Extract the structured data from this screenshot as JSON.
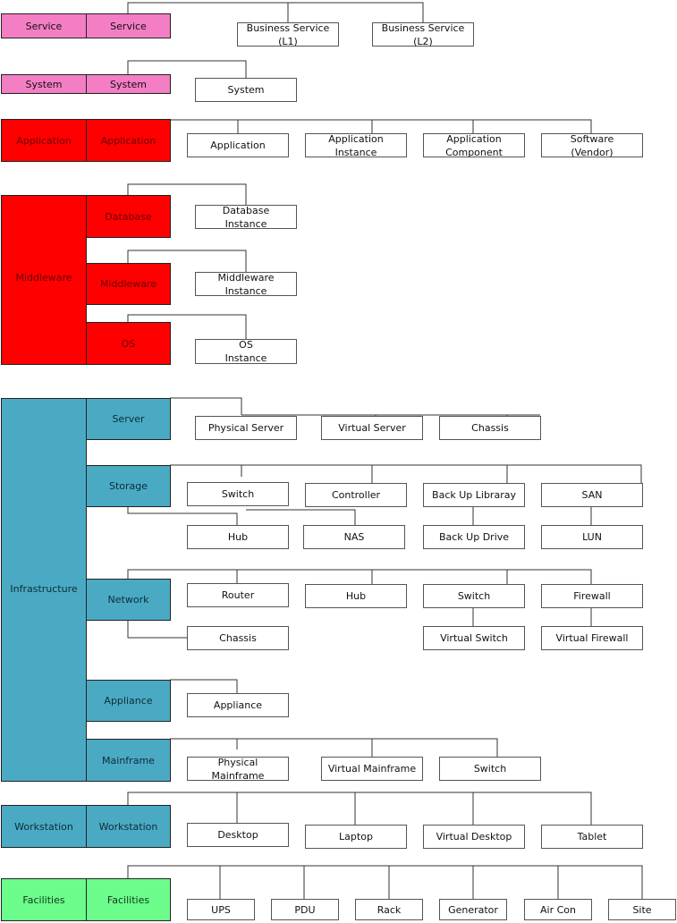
{
  "colors": {
    "service": "#f47ec4",
    "application": "#ff0000",
    "infrastructure": "#4aaac4",
    "facilities": "#6cfc8c",
    "connector": "#333333",
    "child_border": "#555555"
  },
  "layers": [
    {
      "id": "service",
      "label": "Service",
      "color": "pink"
    },
    {
      "id": "system",
      "label": "System",
      "color": "pink"
    },
    {
      "id": "application",
      "label": "Application",
      "color": "red"
    },
    {
      "id": "middleware",
      "label": "Middleware",
      "color": "red"
    },
    {
      "id": "infrastructure",
      "label": "Infrastructure",
      "color": "teal"
    },
    {
      "id": "workstation",
      "label": "Workstation",
      "color": "teal"
    },
    {
      "id": "facilities",
      "label": "Facilities",
      "color": "green"
    }
  ],
  "categories": {
    "service": "Service",
    "system": "System",
    "application": "Application",
    "database": "Database",
    "middleware": "Middleware",
    "os": "OS",
    "server": "Server",
    "storage": "Storage",
    "network": "Network",
    "appliance": "Appliance",
    "mainframe": "Mainframe",
    "workstation": "Workstation",
    "facilities": "Facilities"
  },
  "items": {
    "service": [
      "Business Service\n(L1)",
      "Business Service\n(L2)"
    ],
    "system": [
      "System"
    ],
    "application": [
      "Application",
      "Application\nInstance",
      "Application\nComponent",
      "Software\n(Vendor)"
    ],
    "database": [
      "Database\nInstance"
    ],
    "middleware": [
      "Middleware\nInstance"
    ],
    "os": [
      "OS\nInstance"
    ],
    "server": [
      "Physical Server",
      "Virtual Server",
      "Chassis"
    ],
    "storage_top": [
      "Switch",
      "Controller",
      "Back Up Libraray",
      "SAN"
    ],
    "storage_bottom": [
      "Hub",
      "NAS",
      "Back Up Drive",
      "LUN"
    ],
    "network_top": [
      "Router",
      "Hub",
      "Switch",
      "Firewall"
    ],
    "network_bottom": [
      "Chassis",
      "Virtual Switch",
      "Virtual Firewall"
    ],
    "appliance": [
      "Appliance"
    ],
    "mainframe": [
      "Physical\nMainframe",
      "Virtual Mainframe",
      "Switch"
    ],
    "workstation": [
      "Desktop",
      "Laptop",
      "Virtual Desktop",
      "Tablet"
    ],
    "facilities": [
      "UPS",
      "PDU",
      "Rack",
      "Generator",
      "Air Con",
      "Site"
    ]
  }
}
